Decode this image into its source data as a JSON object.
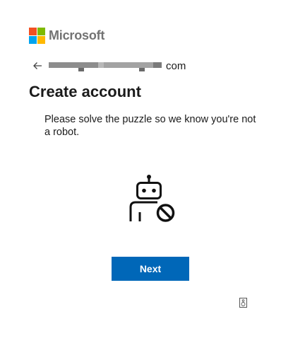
{
  "brand": {
    "name": "Microsoft",
    "logo_icon": "microsoft-logo-icon",
    "colors": {
      "red": "#f25022",
      "green": "#7fba00",
      "blue": "#00a4ef",
      "yellow": "#ffb900"
    }
  },
  "identity": {
    "back_icon": "back-arrow-icon",
    "email_suffix": "com"
  },
  "page": {
    "title": "Create account",
    "description": "Please solve the puzzle so we know you're not a robot."
  },
  "puzzle": {
    "icon": "robot-blocked-icon"
  },
  "actions": {
    "next_label": "Next",
    "accent": "#0067b8"
  },
  "audio": {
    "icon": "speaker-icon"
  }
}
